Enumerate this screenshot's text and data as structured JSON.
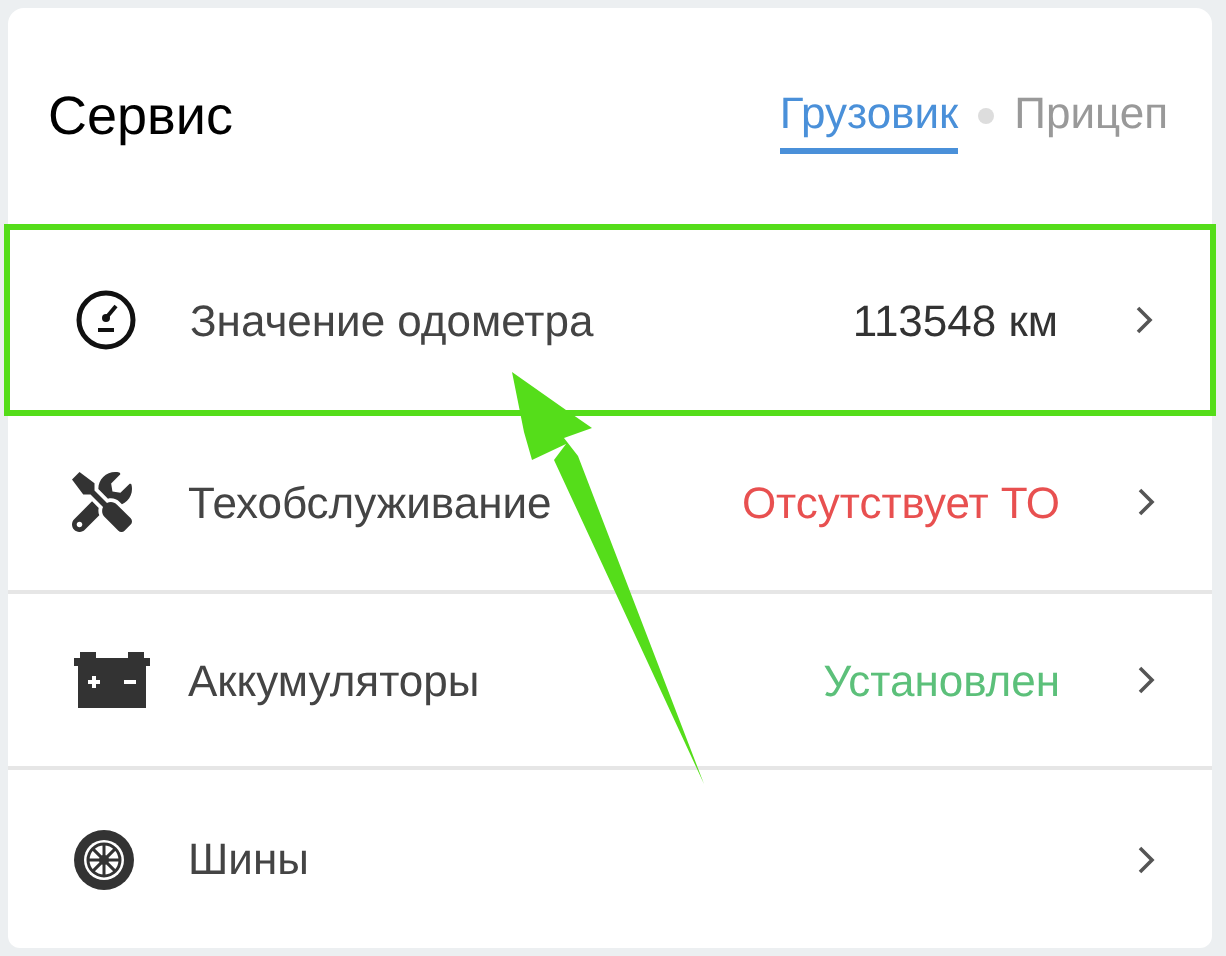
{
  "title": "Сервис",
  "tabs": [
    {
      "label": "Грузовик",
      "selected": true
    },
    {
      "label": "Прицеп",
      "selected": false
    }
  ],
  "items": [
    {
      "kind": "odometer",
      "label": "Значение одометра",
      "value": "113548 км",
      "color": "#333333",
      "highlighted": true
    },
    {
      "kind": "maintenance",
      "label": "Техобслуживание",
      "value": "Отсутствует ТО",
      "color": "#e85050",
      "highlighted": false
    },
    {
      "kind": "battery",
      "label": "Аккумуляторы",
      "value": "Установлен",
      "color": "#5cc07a",
      "highlighted": false
    },
    {
      "kind": "tires",
      "label": "Шины",
      "highlighted": false
    }
  ],
  "annotation": {
    "kind": "arrow"
  }
}
